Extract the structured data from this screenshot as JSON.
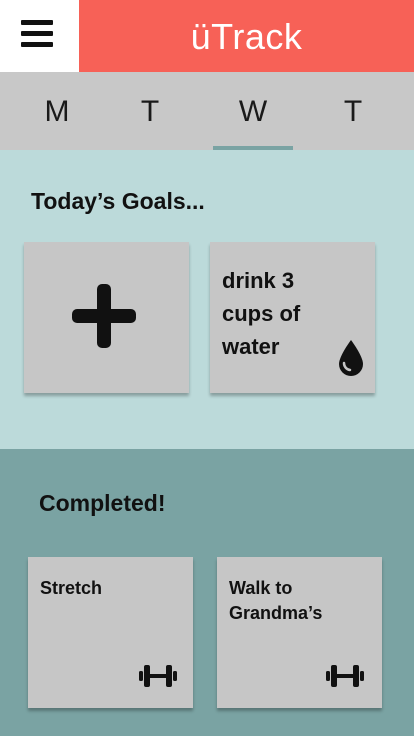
{
  "header": {
    "app_title": "üTrack",
    "menu_icon": "hamburger-icon"
  },
  "days": [
    {
      "label": "M",
      "active": false
    },
    {
      "label": "T",
      "active": false
    },
    {
      "label": "W",
      "active": true
    },
    {
      "label": "T",
      "active": false
    }
  ],
  "goals": {
    "title": "Today’s Goals...",
    "add_icon": "plus-icon",
    "items": [
      {
        "text": "drink 3 cups of water",
        "icon": "water-drop-icon"
      }
    ]
  },
  "completed": {
    "title": "Completed!",
    "items": [
      {
        "text": "Stretch",
        "icon": "dumbbell-icon"
      },
      {
        "text": "Walk to Grandma’s",
        "icon": "dumbbell-icon"
      }
    ]
  },
  "colors": {
    "brand": "#f76157",
    "tab_bar": "#c8c8c8",
    "goals_bg": "#bcdada",
    "completed_bg": "#7aa3a3",
    "card": "#c6c6c6"
  }
}
